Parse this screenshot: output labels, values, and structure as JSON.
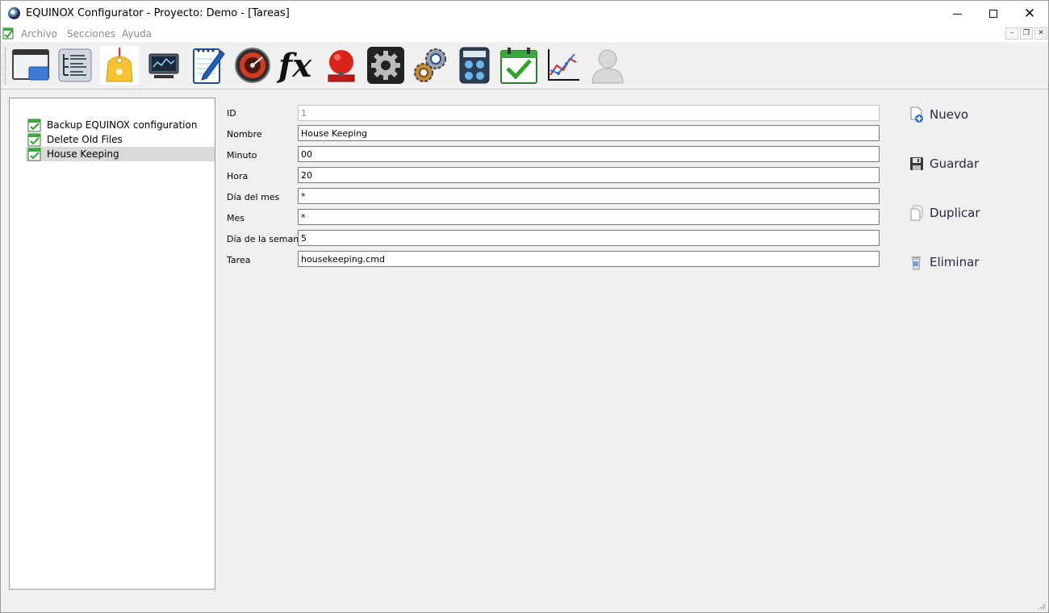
{
  "window": {
    "title": "EQUINOX Configurator - Proyecto: Demo - [Tareas]"
  },
  "menu": {
    "items": [
      "Archivo",
      "Secciones",
      "Ayuda"
    ]
  },
  "toolbar": {
    "icons": [
      "window-icon",
      "tree-list-icon",
      "tag-icon",
      "monitor-icon",
      "notepad-pen-icon",
      "gauge-icon",
      "fx-function-icon",
      "alarm-bell-icon",
      "gear-icon",
      "gears-icon",
      "calculator-icon",
      "calendar-check-icon",
      "line-chart-icon",
      "user-icon"
    ]
  },
  "tree": {
    "items": [
      {
        "label": "Backup EQUINOX configuration",
        "selected": false
      },
      {
        "label": "Delete Old Files",
        "selected": false
      },
      {
        "label": "House Keeping",
        "selected": true
      }
    ]
  },
  "form": {
    "fields": [
      {
        "label": "ID",
        "value": "1",
        "readonly": true
      },
      {
        "label": "Nombre",
        "value": "House Keeping"
      },
      {
        "label": "Minuto",
        "value": "00"
      },
      {
        "label": "Hora",
        "value": "20"
      },
      {
        "label": "Día del mes",
        "value": "*"
      },
      {
        "label": "Mes",
        "value": "*"
      },
      {
        "label": "Día de la semana",
        "value": "5"
      },
      {
        "label": "Tarea",
        "value": "housekeeping.cmd"
      }
    ]
  },
  "actions": {
    "nuevo": "Nuevo",
    "guardar": "Guardar",
    "duplicar": "Duplicar",
    "eliminar": "Eliminar"
  },
  "colors": {
    "selection": "#d9d9d9",
    "action_text": "#222a44",
    "check_green": "#2aa52a"
  }
}
